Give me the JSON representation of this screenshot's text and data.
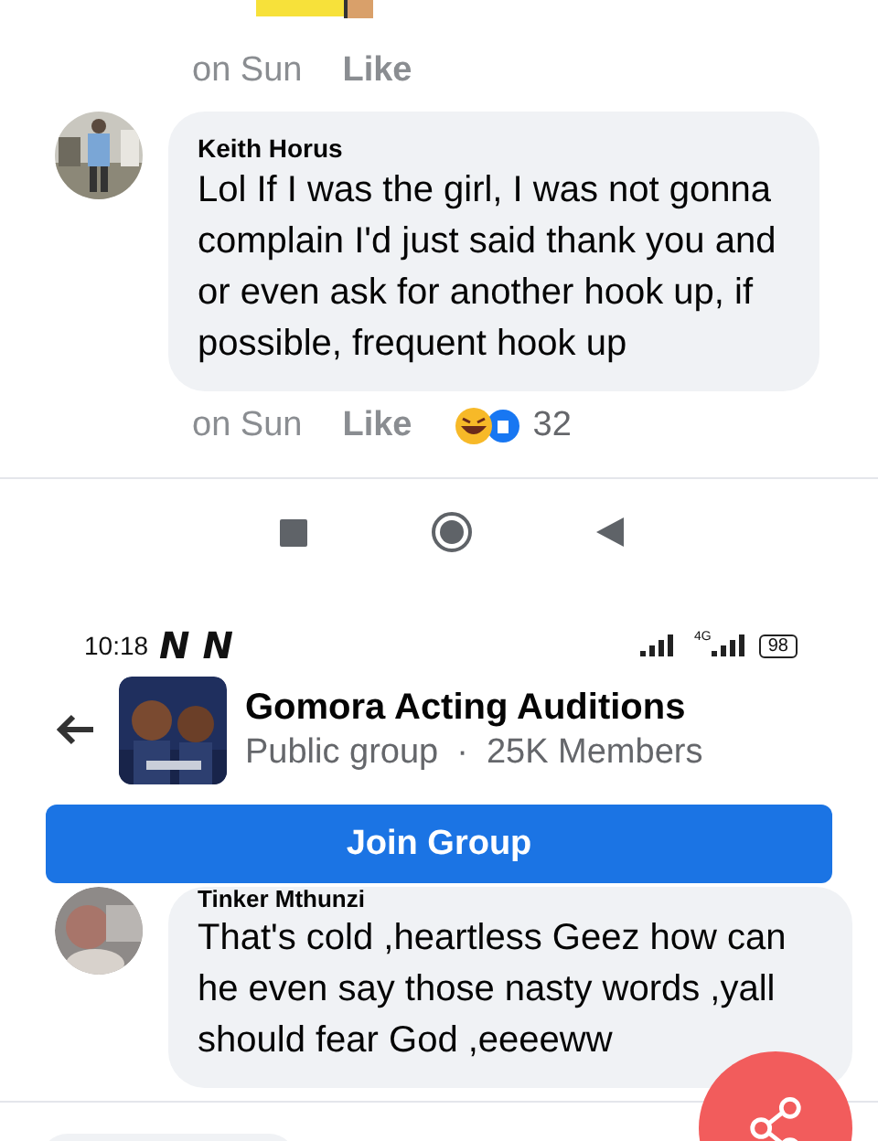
{
  "top_comment": {
    "time": "on Sun",
    "like": "Like"
  },
  "comment": {
    "author": "Keith Horus",
    "text": "Lol If I was the girl, I was not gonna complain I'd just said thank you and or even ask for another hook up, if possible, frequent hook up",
    "time": "on Sun",
    "like": "Like",
    "reaction_count": "32"
  },
  "status_bar": {
    "time": "10:18",
    "notifications": [
      "N",
      "N"
    ],
    "network": "4G",
    "battery": "98"
  },
  "group": {
    "name": "Gomora Acting Auditions",
    "privacy": "Public group",
    "separator": "·",
    "members": "25K Members",
    "join_button": "Join Group"
  },
  "second_comment": {
    "author": "Tinker Mthunzi",
    "text": "That's cold ,heartless Geez how can he even say those nasty words ,yall should fear God ,eeeeww"
  }
}
